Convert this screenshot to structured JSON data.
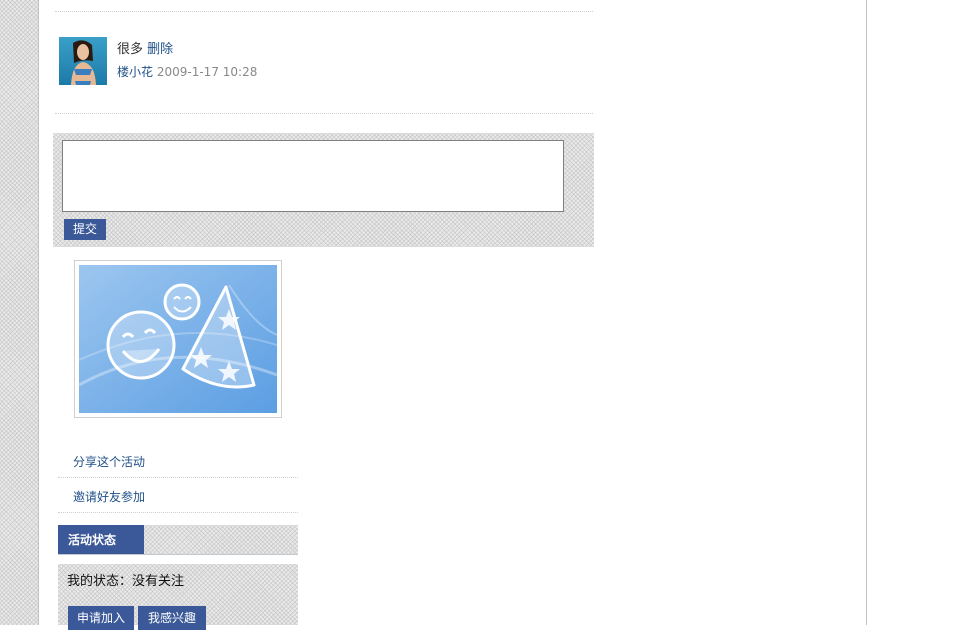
{
  "comment": {
    "avatar_icon": "user-avatar-photo",
    "text": "很多",
    "delete_label": "删除",
    "author": "楼小花",
    "timestamp": "2009-1-17 10:28"
  },
  "reply": {
    "textarea_value": "",
    "submit_label": "提交"
  },
  "event_image": {
    "icon": "party-masks-icon"
  },
  "sidebar": {
    "share_label": "分享这个活动",
    "invite_label": "邀请好友参加"
  },
  "status": {
    "header": "活动状态",
    "my_status": "我的状态：没有关注",
    "join_label": "申请加入",
    "interest_label": "我感兴趣"
  },
  "colors": {
    "accent": "#3b5998",
    "link": "#1f5088",
    "pattern_bg": "#ebebeb"
  }
}
